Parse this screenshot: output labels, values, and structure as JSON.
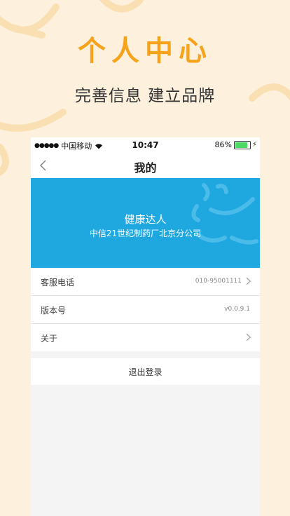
{
  "promo": {
    "title": "个人中心",
    "subtitle": "完善信息 建立品牌"
  },
  "status_bar": {
    "signal_dots": "●●●●●",
    "carrier": "中国移动",
    "time": "10:47",
    "battery": "86%",
    "battery_level": 0.86
  },
  "nav": {
    "title": "我的",
    "back_icon": "chevron-left-icon"
  },
  "profile": {
    "name": "健康达人",
    "company": "中信21世纪制药厂北京分公司",
    "color": "#1fa7e0"
  },
  "settings": [
    {
      "label": "客服电话",
      "value": "010-95001111",
      "arrow": true
    },
    {
      "label": "版本号",
      "value": "v0.0.9.1",
      "arrow": false
    },
    {
      "label": "关于",
      "value": "",
      "arrow": true
    }
  ],
  "logout": {
    "label": "退出登录"
  },
  "colors": {
    "accent": "#f7a21b",
    "background": "#fdf1dd"
  }
}
